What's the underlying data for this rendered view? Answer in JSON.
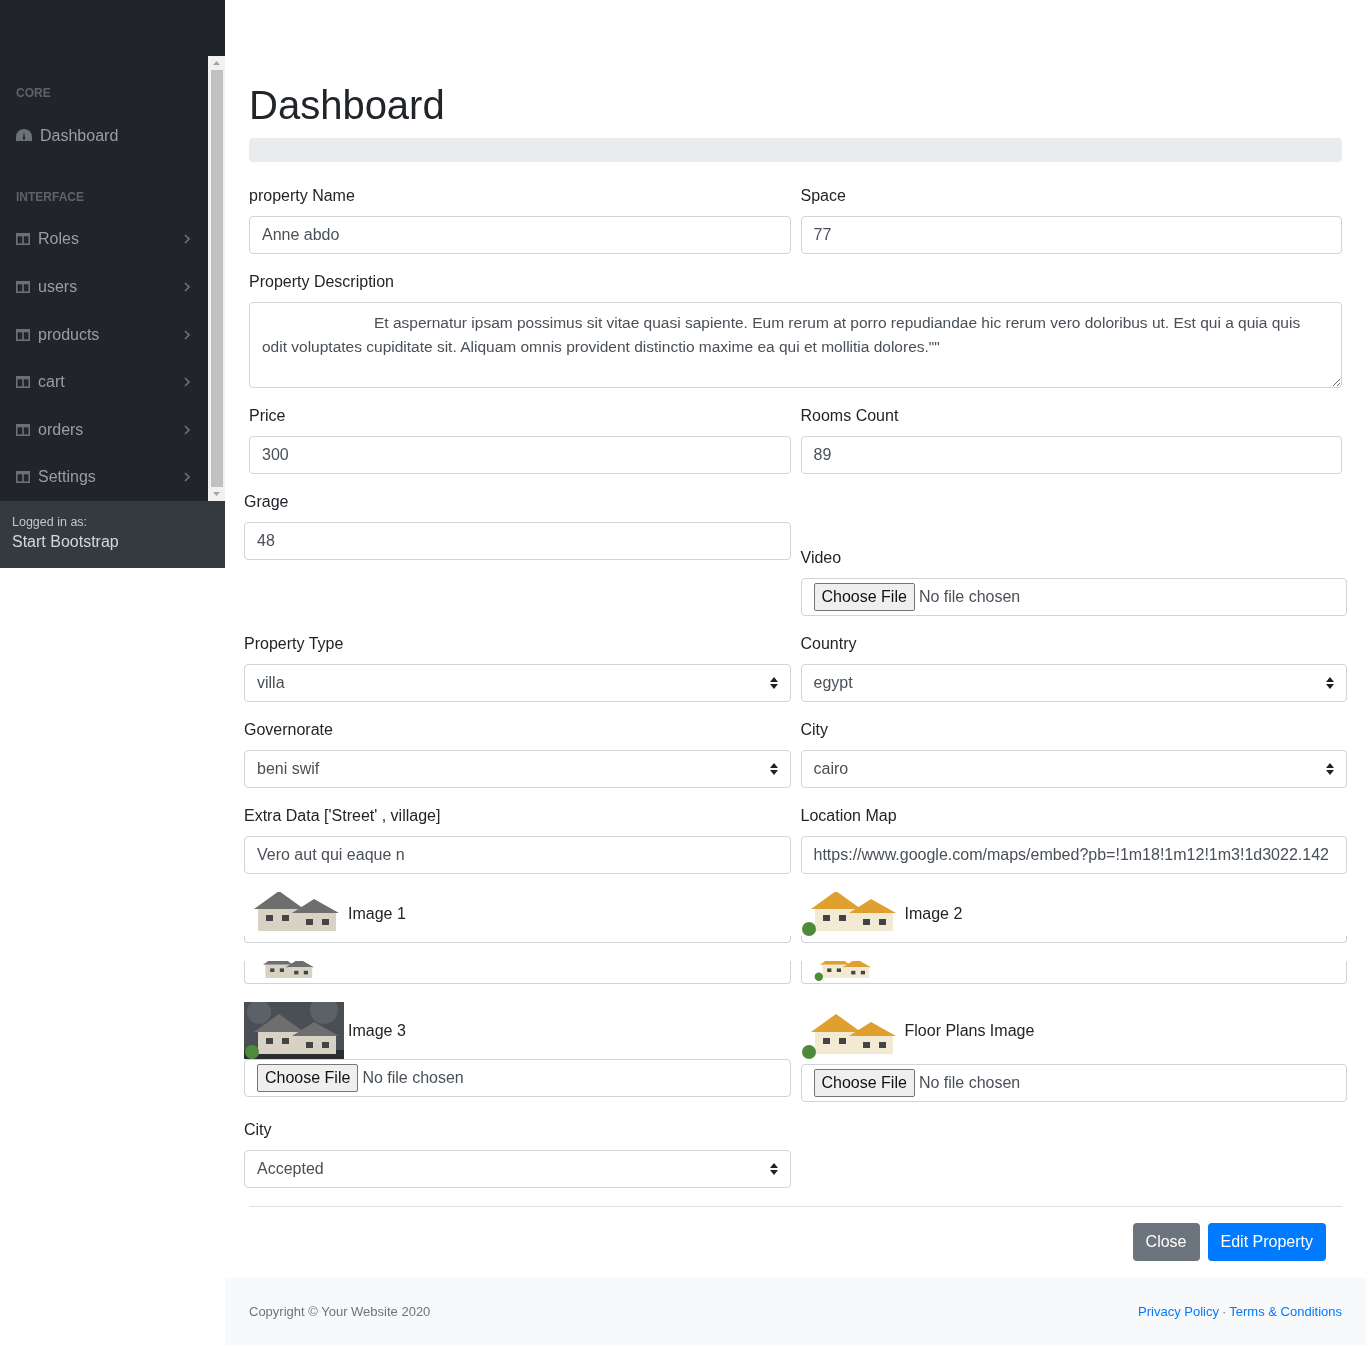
{
  "sidebar": {
    "sections": [
      {
        "heading": "CORE",
        "items": [
          {
            "label": "Dashboard",
            "kind": "link",
            "expandable": false
          }
        ]
      },
      {
        "heading": "INTERFACE",
        "items": [
          {
            "label": "Roles",
            "kind": "collapse",
            "expandable": true
          },
          {
            "label": "users",
            "kind": "collapse",
            "expandable": true
          },
          {
            "label": "products",
            "kind": "collapse",
            "expandable": true
          },
          {
            "label": "cart",
            "kind": "collapse",
            "expandable": true
          },
          {
            "label": "orders",
            "kind": "collapse",
            "expandable": true
          },
          {
            "label": "Settings",
            "kind": "collapse",
            "expandable": true
          }
        ]
      }
    ],
    "footer": {
      "caption": "Logged in as:",
      "user": "Start Bootstrap"
    }
  },
  "page": {
    "title": "Dashboard"
  },
  "form": {
    "sections": [
      {
        "rows": [
          [
            {
              "kind": "text",
              "label": "property Name",
              "value": "Anne abdo"
            },
            {
              "kind": "text",
              "label": "Space",
              "value": "77"
            }
          ],
          [
            {
              "kind": "textarea",
              "label": "Property Description",
              "value": "                          Et aspernatur ipsam possimus sit vitae quasi sapiente. Eum rerum at porro repudiandae hic rerum vero doloribus ut. Est qui a quia quis odit voluptates cupiditate sit. Aliquam omnis provident distinctio maxime ea qui et mollitia dolores.\"\""
            }
          ],
          [
            {
              "kind": "text",
              "label": "Price",
              "value": "300"
            },
            {
              "kind": "text",
              "label": "Rooms Count",
              "value": "89"
            }
          ]
        ]
      },
      {
        "rows": [
          [
            {
              "kind": "text",
              "label": "Grage",
              "value": "48"
            },
            {
              "kind": "file",
              "label": "Video",
              "button": "Choose File",
              "status": "No file chosen"
            }
          ],
          [
            {
              "kind": "select",
              "label": "Property Type",
              "value": "villa"
            },
            {
              "kind": "select",
              "label": "Country",
              "value": "egypt"
            }
          ],
          [
            {
              "kind": "select",
              "label": "Governorate",
              "value": "beni swif"
            },
            {
              "kind": "select",
              "label": "City",
              "value": "cairo"
            }
          ],
          [
            {
              "kind": "text",
              "label": "Extra Data ['Street' , village]",
              "value": "Vero aut qui eaque n"
            },
            {
              "kind": "text",
              "label": "Location Map",
              "value": "https://www.google.com/maps/embed?pb=!1m18!1m12!1m3!1d3022.142"
            }
          ],
          [
            {
              "kind": "image_file",
              "label": "Image 1",
              "clipped": true
            },
            {
              "kind": "image_file",
              "label": "Image 2",
              "clipped": true
            }
          ],
          [
            {
              "kind": "image_file",
              "label": "Image 3",
              "clipped": false,
              "button": "Choose File",
              "status": "No file chosen"
            },
            {
              "kind": "image_file",
              "label": "Floor Plans Image",
              "clipped": false,
              "button": "Choose File",
              "status": "No file chosen"
            }
          ],
          [
            {
              "kind": "select",
              "label": "City",
              "value": "Accepted"
            }
          ]
        ]
      }
    ]
  },
  "buttons": [
    {
      "label": "Close",
      "kind": "secondary"
    },
    {
      "label": "Edit Property",
      "kind": "primary"
    }
  ],
  "footer": {
    "copyright": "Copyright © Your Website 2020",
    "links": [
      "Privacy Policy",
      "Terms & Conditions"
    ],
    "separator": "·"
  }
}
